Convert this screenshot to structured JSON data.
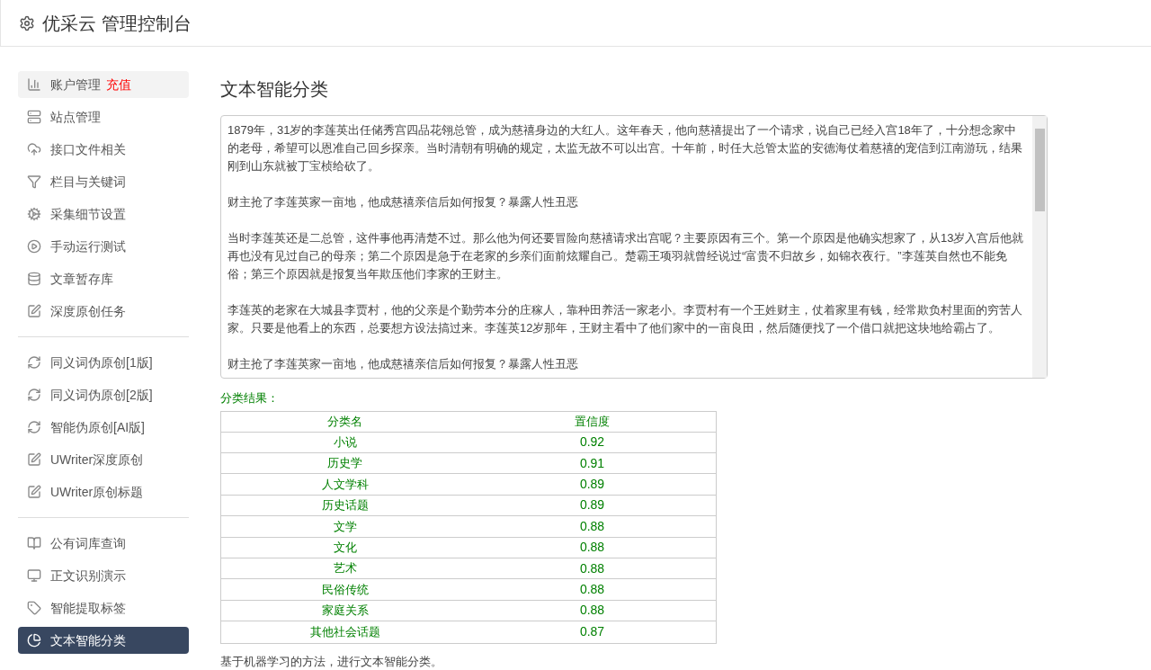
{
  "header": {
    "title": "优采云 管理控制台"
  },
  "sidebar": {
    "groups": [
      {
        "items": [
          {
            "label": "账户管理",
            "badge": "充值",
            "selected": false
          },
          {
            "label": "站点管理",
            "selected": false
          },
          {
            "label": "接口文件相关",
            "selected": false
          },
          {
            "label": "栏目与关键词",
            "selected": false
          },
          {
            "label": "采集细节设置",
            "selected": false
          },
          {
            "label": "手动运行测试",
            "selected": false
          },
          {
            "label": "文章暂存库",
            "selected": false
          },
          {
            "label": "深度原创任务",
            "selected": false
          }
        ]
      },
      {
        "items": [
          {
            "label": "同义词伪原创[1版]",
            "selected": false
          },
          {
            "label": "同义词伪原创[2版]",
            "selected": false
          },
          {
            "label": "智能伪原创[AI版]",
            "selected": false
          },
          {
            "label": "UWriter深度原创",
            "selected": false
          },
          {
            "label": "UWriter原创标题",
            "selected": false
          }
        ]
      },
      {
        "items": [
          {
            "label": "公有词库查询",
            "selected": false
          },
          {
            "label": "正文识别演示",
            "selected": false
          },
          {
            "label": "智能提取标签",
            "selected": false
          },
          {
            "label": "文本智能分类",
            "selected": true
          }
        ]
      }
    ]
  },
  "main": {
    "title": "文本智能分类",
    "text_area": {
      "paragraphs": [
        "1879年，31岁的李莲英出任储秀宫四品花翎总管，成为慈禧身边的大红人。这年春天，他向慈禧提出了一个请求，说自己已经入宫18年了，十分想念家中的老母，希望可以恩准自己回乡探亲。当时清朝有明确的规定，太监无故不可以出宫。十年前，时任大总管太监的安德海仗着慈禧的宠信到江南游玩，结果刚到山东就被丁宝桢给砍了。",
        "财主抢了李莲英家一亩地，他成慈禧亲信后如何报复？暴露人性丑恶",
        "当时李莲英还是二总管，这件事他再清楚不过。那么他为何还要冒险向慈禧请求出宫呢？主要原因有三个。第一个原因是他确实想家了，从13岁入宫后他就再也没有见过自己的母亲；第二个原因是急于在老家的乡亲们面前炫耀自己。楚霸王项羽就曾经说过“富贵不归故乡，如锦衣夜行。”李莲英自然也不能免俗；第三个原因就是报复当年欺压他们李家的王财主。",
        "李莲英的老家在大城县李贾村，他的父亲是个勤劳本分的庄稼人，靠种田养活一家老小。李贾村有一个王姓财主，仗着家里有钱，经常欺负村里面的穷苦人家。只要是他看上的东西，总要想方设法搞过来。李莲英12岁那年，王财主看中了他们家中的一亩良田，然后随便找了一个借口就把这块地给霸占了。",
        "财主抢了李莲英家一亩地，他成慈禧亲信后如何报复？暴露人性丑恶"
      ]
    },
    "result_label": "分类结果：",
    "table": {
      "columns": [
        "分类名",
        "置信度"
      ],
      "rows": [
        [
          "小说",
          "0.92"
        ],
        [
          "历史学",
          "0.91"
        ],
        [
          "人文学科",
          "0.89"
        ],
        [
          "历史话题",
          "0.89"
        ],
        [
          "文学",
          "0.88"
        ],
        [
          "文化",
          "0.88"
        ],
        [
          "艺术",
          "0.88"
        ],
        [
          "民俗传统",
          "0.88"
        ],
        [
          "家庭关系",
          "0.88"
        ],
        [
          "其他社会话题",
          "0.87"
        ]
      ]
    },
    "note": "基于机器学习的方法，进行文本智能分类。"
  }
}
